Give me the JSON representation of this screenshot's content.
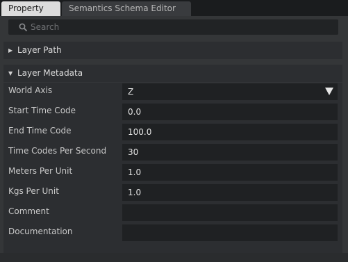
{
  "tabs": [
    {
      "label": "Property",
      "active": true
    },
    {
      "label": "Semantics Schema Editor",
      "active": false
    }
  ],
  "search": {
    "placeholder": "Search",
    "value": ""
  },
  "sections": {
    "layer_path": {
      "label": "Layer Path",
      "expanded": false
    },
    "layer_metadata": {
      "label": "Layer Metadata",
      "expanded": true,
      "rows": [
        {
          "label": "World Axis",
          "value": "Z",
          "type": "dropdown"
        },
        {
          "label": "Start Time Code",
          "value": "0.0",
          "type": "text"
        },
        {
          "label": "End Time Code",
          "value": "100.0",
          "type": "text"
        },
        {
          "label": "Time Codes Per Second",
          "value": "30",
          "type": "text"
        },
        {
          "label": "Meters Per Unit",
          "value": "1.0",
          "type": "text"
        },
        {
          "label": "Kgs Per Unit",
          "value": "1.0",
          "type": "text"
        },
        {
          "label": "Comment",
          "value": "",
          "type": "text"
        },
        {
          "label": "Documentation",
          "value": "",
          "type": "text"
        }
      ]
    }
  },
  "icons": {
    "search": "search-icon",
    "collapsed": "triangle-right-icon",
    "expanded": "triangle-down-icon",
    "dropdown": "dropdown-caret-icon"
  },
  "colors": {
    "background": "#343638",
    "section": "#2c2e31",
    "field": "#1f2123",
    "tab_active": "#dcdcdc",
    "tab_inactive": "#393b3e"
  }
}
